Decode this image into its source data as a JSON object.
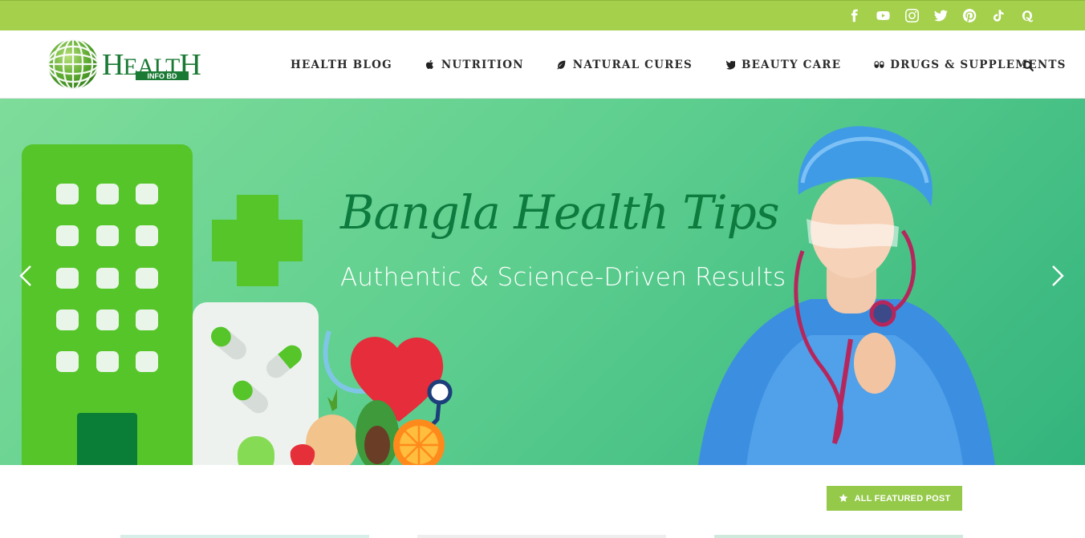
{
  "topbar": {
    "social": [
      {
        "name": "facebook-icon"
      },
      {
        "name": "youtube-icon"
      },
      {
        "name": "instagram-icon"
      },
      {
        "name": "twitter-icon"
      },
      {
        "name": "pinterest-icon"
      },
      {
        "name": "tiktok-icon"
      },
      {
        "name": "quora-icon"
      }
    ]
  },
  "header": {
    "logo": {
      "main": "HEALTH",
      "sub": "INFO BD"
    },
    "nav": [
      {
        "label": "HEALTH BLOG",
        "icon": ""
      },
      {
        "label": "NUTRITION",
        "icon": "apple-icon"
      },
      {
        "label": "NATURAL CURES",
        "icon": "leaf-icon"
      },
      {
        "label": "BEAUTY CARE",
        "icon": "bird-icon"
      },
      {
        "label": "DRUGS & SUPPLEMENTS",
        "icon": "pills-icon"
      }
    ],
    "search_icon": "search-icon"
  },
  "hero": {
    "title": "Bangla Health Tips",
    "subtitle": "Authentic & Science-Driven Results",
    "prev_icon": "chevron-left-icon",
    "next_icon": "chevron-right-icon"
  },
  "featured": {
    "button_label": "ALL FEATURED POST",
    "icon": "star-icon"
  },
  "colors": {
    "topbar": "#a4d04c",
    "accent_green": "#94c94a",
    "hero_title": "#0d7a3e",
    "logo_green": "#1a7a34"
  }
}
